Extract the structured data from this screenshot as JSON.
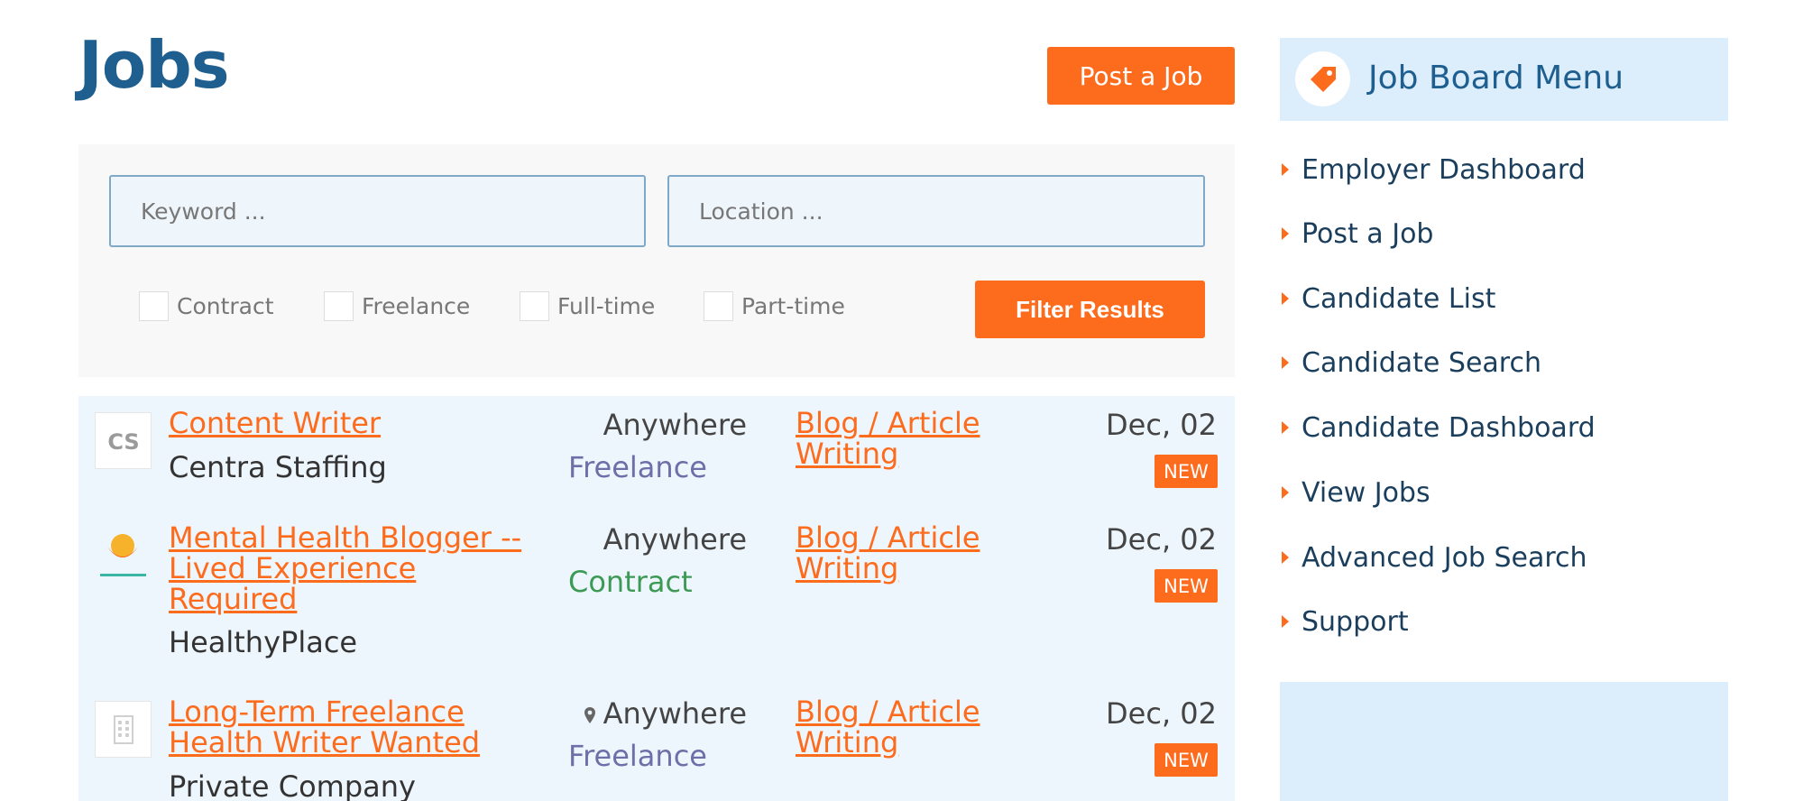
{
  "page": {
    "title": "Jobs",
    "post_job_label": "Post a Job"
  },
  "filters": {
    "keyword_placeholder": "Keyword ...",
    "location_placeholder": "Location ...",
    "types": [
      "Contract",
      "Freelance",
      "Full-time",
      "Part-time"
    ],
    "submit_label": "Filter Results"
  },
  "jobs": [
    {
      "logo": "CS",
      "title_lines": [
        "Content Writer"
      ],
      "company": "Centra Staffing",
      "location": "Anywhere",
      "type": "Freelance",
      "category_lines": [
        "Blog / Article",
        "Writing"
      ],
      "date": "Dec, 02",
      "badge": "NEW"
    },
    {
      "logo": "HealthyPlace",
      "title_lines": [
        "Mental Health Blogger --",
        "Lived Experience",
        "Required"
      ],
      "company": "HealthyPlace",
      "location": "Anywhere",
      "type": "Contract",
      "category_lines": [
        "Blog / Article",
        "Writing"
      ],
      "date": "Dec, 02",
      "badge": "NEW"
    },
    {
      "logo": "building-icon",
      "title_lines": [
        "Long-Term Freelance",
        "Health Writer Wanted"
      ],
      "company": "Private Company",
      "location": "Anywhere",
      "type": "Freelance",
      "category_lines": [
        "Blog / Article",
        "Writing"
      ],
      "date": "Dec, 02",
      "badge": "NEW"
    }
  ],
  "sidebar": {
    "title": "Job Board Menu",
    "items": [
      "Employer Dashboard",
      "Post a Job",
      "Candidate List",
      "Candidate Search",
      "Candidate Dashboard",
      "View Jobs",
      "Advanced Job Search",
      "Support"
    ]
  },
  "colors": {
    "accent": "#fd6b1d",
    "brand_blue": "#1e5f8f",
    "panel_blue": "#eef6fd",
    "freelance": "#6c6fa8",
    "contract": "#3d9a55"
  }
}
